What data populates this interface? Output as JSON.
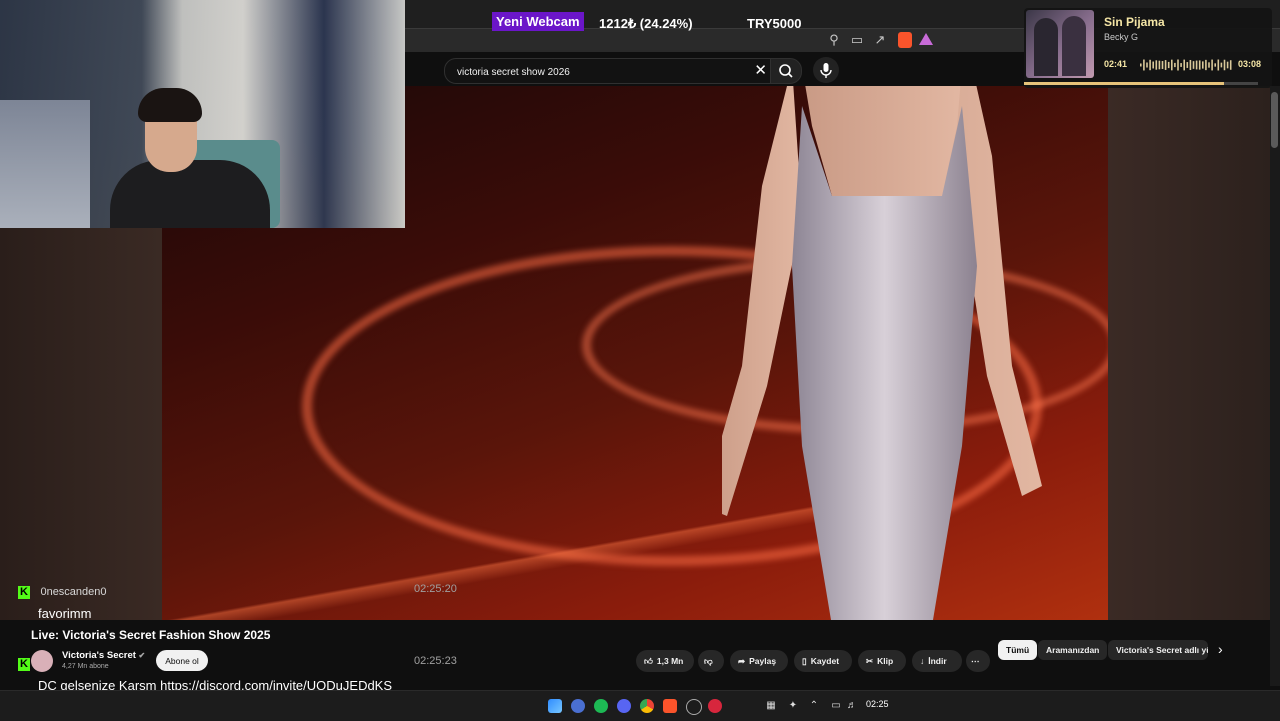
{
  "overlay": {
    "alert_label": "Yeni Webcam",
    "goal_progress": "1212₺ (24.24%)",
    "goal_target": "TRY5000"
  },
  "search": {
    "value": "victoria secret show 2026"
  },
  "music": {
    "title": "Sin Pijama",
    "artist": "Becky G",
    "elapsed": "02:41",
    "total": "03:08",
    "progress": 0.855
  },
  "chat": {
    "messages": [
      {
        "user": "0nescanden0",
        "text": "favorimm",
        "time": "02:25:20"
      },
      {
        "user": "",
        "text": "DC gelsenize Karşm ",
        "link": "https://discord.com/invite/UQDuJEDdKS",
        "time": "02:25:23"
      }
    ]
  },
  "video": {
    "title": "Live: Victoria's Secret Fashion Show 2025",
    "channel": "Victoria's Secret",
    "subscribers": "4,27 Mn abone",
    "subscribe_label": "Abone ol",
    "likes": "1,3 Mn",
    "share_label": "Paylaş",
    "save_label": "Kaydet",
    "clip_label": "Klip",
    "download_label": "İndir"
  },
  "chips": [
    "Tümü",
    "Aramanızdan",
    "Victoria's Secret adlı yük"
  ],
  "taskbar": {
    "clock": "02:25"
  },
  "colors": {
    "alert_bg": "#6b16c9",
    "kick_green": "#53fc18",
    "music_accent": "#f5e6a6"
  }
}
